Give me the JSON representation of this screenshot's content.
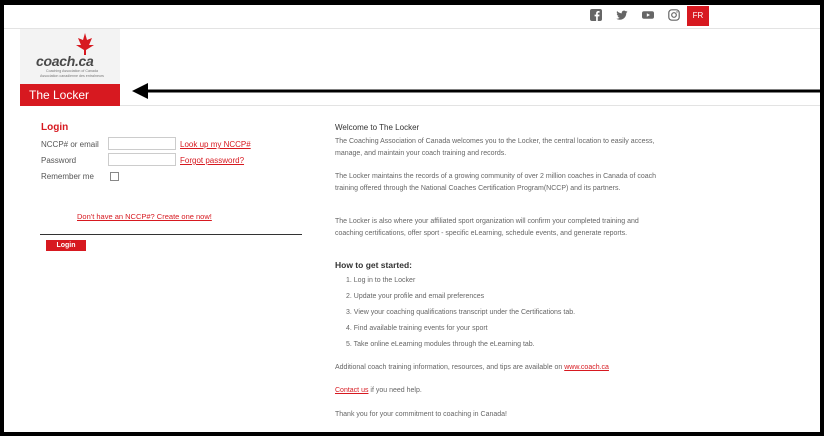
{
  "topbar": {
    "social_icons": [
      "facebook-icon",
      "twitter-icon",
      "youtube-icon",
      "instagram-icon"
    ],
    "language_button": "FR"
  },
  "brand": {
    "wordmark": "coach.ca",
    "tagline_en": "Coaching Association of Canada",
    "tagline_fr": "Association canadienne des entraîneurs",
    "section_title": "The Locker",
    "accent_color": "#d71920"
  },
  "login": {
    "title": "Login",
    "id_label": "NCCP# or email",
    "id_value": "",
    "lookup_link": "Look up my NCCP#",
    "password_label": "Password",
    "password_value": "",
    "forgot_link": "Forgot password?",
    "remember_label": "Remember me",
    "remember_checked": false,
    "create_text": "Don't have an NCCP#? Create one now!",
    "submit_label": "Login"
  },
  "welcome": {
    "title": "Welcome to The Locker",
    "paragraphs": [
      "The Coaching Association of Canada welcomes you to the Locker, the central location to easily access, manage, and maintain your coach training and records.",
      "The Locker maintains the records of a growing community of over 2 million coaches in Canada of coach training offered through the National Coaches Certification Program(NCCP) and its partners.",
      "The Locker is also where your affiliated sport organization will confirm your completed training and coaching certifications, offer sport - specific eLearning, schedule events, and generate reports."
    ],
    "how_title": "How to get started:",
    "steps": [
      "1.  Log in to the Locker",
      "2.  Update your profile and email preferences",
      "3.  View your coaching qualifications transcript under the Certifications tab.",
      "4.  Find available training events for your sport",
      "5.  Take online eLearning modules through the eLearning tab."
    ],
    "additional_text": "Additional coach training information, resources, and tips are available on ",
    "additional_link": "www.coach.ca",
    "contact_link": "Contact us",
    "contact_text": " if you need help.",
    "thanks": "Thank you for your commitment to coaching in Canada!"
  }
}
